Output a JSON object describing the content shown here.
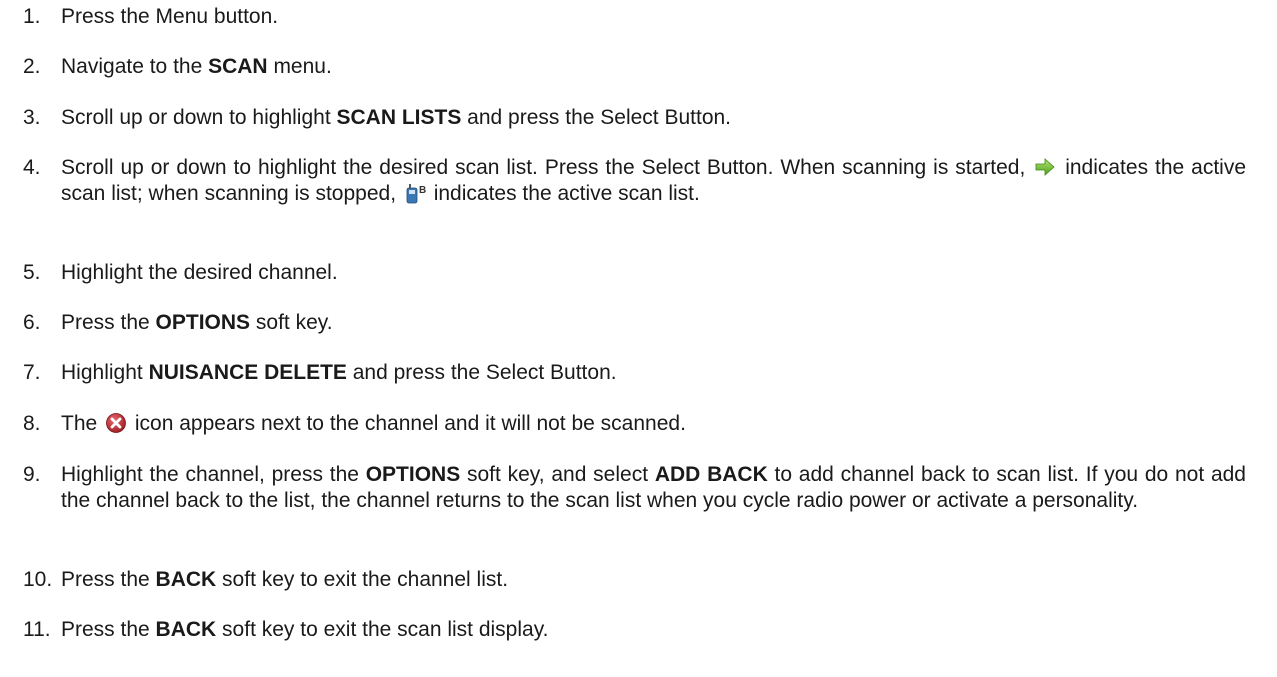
{
  "steps": [
    {
      "n": "1.",
      "segments": [
        {
          "text": "Press the Menu button."
        }
      ]
    },
    {
      "n": "2.",
      "segments": [
        {
          "text": "Navigate to the "
        },
        {
          "text": "SCAN",
          "bold": true
        },
        {
          "text": " menu."
        }
      ]
    },
    {
      "n": "3.",
      "segments": [
        {
          "text": "Scroll up or down to highlight "
        },
        {
          "text": "SCAN LISTS",
          "bold": true
        },
        {
          "text": " and press the Select Button."
        }
      ]
    },
    {
      "n": "4.",
      "segments": [
        {
          "text": "Scroll up or down to highlight the desired scan list. Press the Select Button. When scanning is started, "
        },
        {
          "icon": "scan-active-arrow-icon"
        },
        {
          "text": " indicates the active scan list; when scanning is stopped, "
        },
        {
          "icon": "scan-stopped-radio-icon"
        },
        {
          "text": " indicates the active scan list."
        }
      ]
    },
    {
      "n": "5.",
      "segments": [
        {
          "text": "Highlight the desired channel."
        }
      ]
    },
    {
      "n": "6.",
      "segments": [
        {
          "text": "Press the "
        },
        {
          "text": "OPTIONS",
          "bold": true
        },
        {
          "text": " soft key."
        }
      ]
    },
    {
      "n": "7.",
      "segments": [
        {
          "text": "Highlight "
        },
        {
          "text": "NUISANCE DELETE",
          "bold": true
        },
        {
          "text": " and press the Select Button."
        }
      ]
    },
    {
      "n": "8.",
      "segments": [
        {
          "text": "The "
        },
        {
          "icon": "nuisance-delete-x-icon"
        },
        {
          "text": " icon appears next to the channel and it will not be scanned."
        }
      ]
    },
    {
      "n": "9.",
      "segments": [
        {
          "text": "Highlight the channel, press the "
        },
        {
          "text": "OPTIONS",
          "bold": true
        },
        {
          "text": " soft key, and select "
        },
        {
          "text": "ADD BACK",
          "bold": true
        },
        {
          "text": " to add channel back to scan list. If you do not add the channel back to the list, the channel returns to the scan list when you cycle radio power or activate a personality."
        }
      ]
    },
    {
      "n": "10.",
      "segments": [
        {
          "text": "Press the "
        },
        {
          "text": "BACK",
          "bold": true
        },
        {
          "text": " soft key to exit the channel list."
        }
      ]
    },
    {
      "n": "11.",
      "segments": [
        {
          "text": "Press the "
        },
        {
          "text": "BACK",
          "bold": true
        },
        {
          "text": " soft key to exit the scan list display."
        }
      ]
    }
  ],
  "colors": {
    "text": "#1a1a1a",
    "arrow_green": "#7ac943",
    "x_red": "#c0272d"
  }
}
